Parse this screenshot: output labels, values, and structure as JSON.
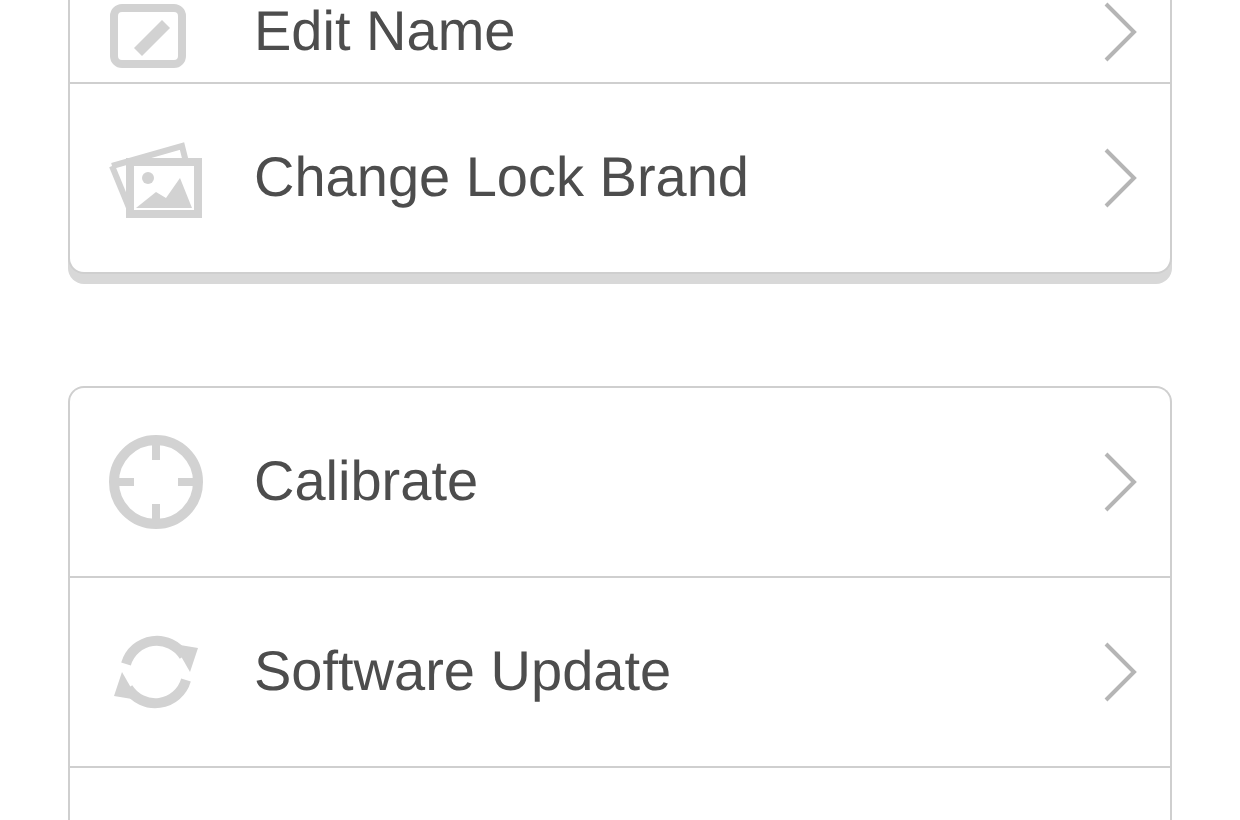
{
  "groups": [
    {
      "items": [
        {
          "kind": "edit",
          "label": "Edit Name"
        },
        {
          "kind": "brand",
          "label": "Change Lock Brand"
        }
      ]
    },
    {
      "items": [
        {
          "kind": "calibrate",
          "label": "Calibrate"
        },
        {
          "kind": "update",
          "label": "Software Update"
        }
      ]
    }
  ]
}
